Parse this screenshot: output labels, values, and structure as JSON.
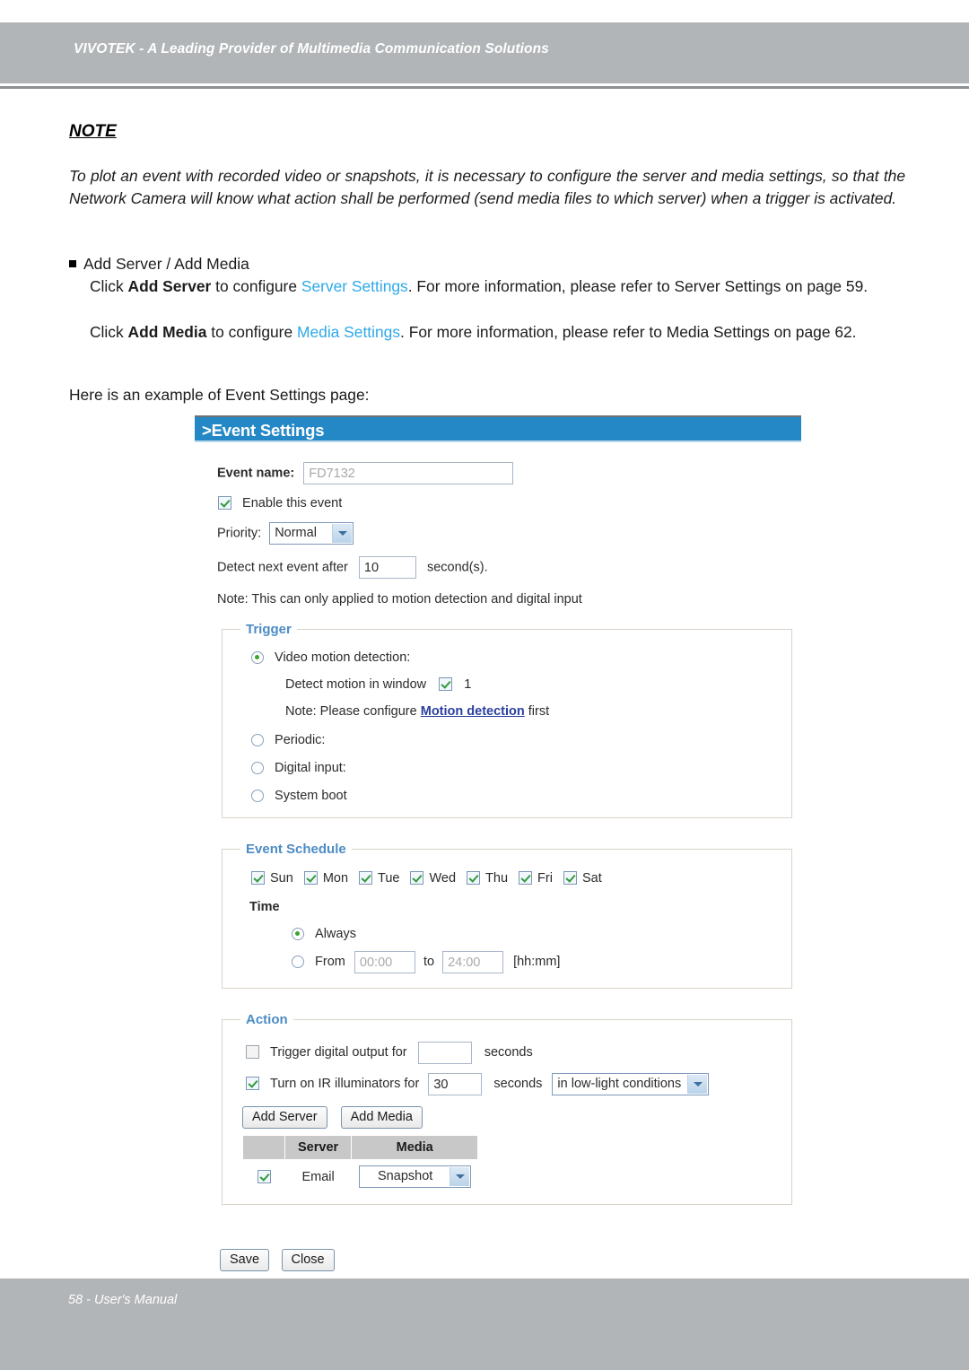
{
  "header": {
    "title": "VIVOTEK - A Leading Provider of Multimedia Communication Solutions"
  },
  "note": {
    "heading": "NOTE",
    "body": "To plot an event with recorded video or snapshots, it is necessary to configure the server and media settings, so that the Network Camera will know what action shall be performed (send media files to which server) when a trigger is activated."
  },
  "section": {
    "bullet": "Add Server / Add Media",
    "para1_pre": "Click ",
    "para1_b1": "Add Server",
    "para1_mid": " to configure ",
    "para1_link": "Server Settings",
    "para1_post": ". For more information, please refer to Server Settings on page 59.",
    "para2_pre": "Click ",
    "para2_b1": "Add Media",
    "para2_mid": " to configure ",
    "para2_link": "Media Settings",
    "para2_post": ". For more information, please refer to Media Settings on page 62.",
    "example": "Here is an example of Event Settings page:"
  },
  "panel": {
    "title": ">Event Settings",
    "event_name_label": "Event name:",
    "event_name_value": "FD7132",
    "enable_event_label": "Enable this event",
    "enable_event_checked": true,
    "priority_label": "Priority:",
    "priority_value": "Normal",
    "priority_options": [
      "Normal"
    ],
    "detect_next_label": "Detect next event after",
    "detect_next_value": "10",
    "detect_next_suffix": "second(s).",
    "note_text": "Note: This can only applied to motion detection and digital input"
  },
  "trigger": {
    "legend": "Trigger",
    "options": [
      {
        "label": "Video motion detection:",
        "selected": true
      },
      {
        "label": "Periodic:",
        "selected": false
      },
      {
        "label": "Digital input:",
        "selected": false
      },
      {
        "label": "System boot",
        "selected": false
      }
    ],
    "detect_window_label": "Detect motion in window",
    "detect_window_checked": true,
    "detect_window_number": "1",
    "md_note_pre": "Note: Please configure ",
    "md_note_link": "Motion detection",
    "md_note_post": " first"
  },
  "schedule": {
    "legend": "Event Schedule",
    "days": [
      {
        "label": "Sun",
        "checked": true
      },
      {
        "label": "Mon",
        "checked": true
      },
      {
        "label": "Tue",
        "checked": true
      },
      {
        "label": "Wed",
        "checked": true
      },
      {
        "label": "Thu",
        "checked": true
      },
      {
        "label": "Fri",
        "checked": true
      },
      {
        "label": "Sat",
        "checked": true
      }
    ],
    "time_label": "Time",
    "always_label": "Always",
    "always_selected": true,
    "from_label": "From",
    "from_value": "00:00",
    "to_label": "to",
    "to_value": "24:00",
    "format_hint": "[hh:mm]"
  },
  "action": {
    "legend": "Action",
    "digital_output_label": "Trigger digital output for",
    "digital_output_checked": false,
    "digital_output_value": "",
    "digital_output_suffix": "seconds",
    "ir_label": "Turn on IR illuminators for",
    "ir_checked": true,
    "ir_value": "30",
    "ir_suffix": "seconds",
    "ir_condition_value": "in low-light conditions",
    "ir_condition_options": [
      "in low-light conditions"
    ],
    "add_server_button": "Add Server",
    "add_media_button": "Add Media",
    "table_headers": [
      "",
      "Server",
      "Media"
    ],
    "rows": [
      {
        "checked": true,
        "server": "Email",
        "media": "Snapshot"
      }
    ]
  },
  "footer_buttons": {
    "save": "Save",
    "close": "Close"
  },
  "footer": {
    "text": "58 - User's Manual"
  }
}
